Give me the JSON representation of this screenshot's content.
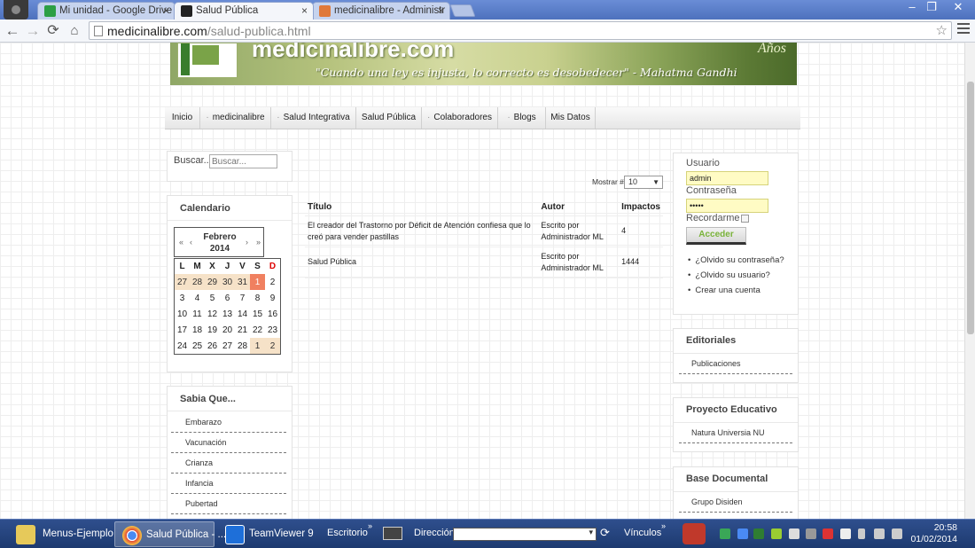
{
  "browser": {
    "tabs": [
      {
        "label": "Mi unidad - Google Drive",
        "active": false,
        "favicon_color": "#2c9f45"
      },
      {
        "label": "Salud Pública",
        "active": true,
        "favicon_color": "#222222"
      },
      {
        "label": "medicinalibre - Administr",
        "active": false,
        "favicon_color": "#e0793a"
      }
    ],
    "url_domain": "medicinalibre.com",
    "url_path": "/salud-publica.html"
  },
  "banner": {
    "brand": "medicinalibre.com",
    "quote": "\"Cuando una ley es injusta, lo correcto es desobedecer\" - Mahatma Gandhi",
    "badge": "Años"
  },
  "mainnav": {
    "items": [
      "Inicio",
      "medicinalibre",
      "Salud Integrativa",
      "Salud Pública",
      "Colaboradores",
      "Blogs",
      "Mis Datos"
    ]
  },
  "search": {
    "label": "Buscar...",
    "placeholder": "Buscar..."
  },
  "calendar": {
    "title": "Calendario",
    "month": "Febrero",
    "year": "2014",
    "prev_year": "«",
    "prev_month": "‹",
    "next_month": "›",
    "next_year": "»",
    "weekdays": [
      "L",
      "M",
      "X",
      "J",
      "V",
      "S",
      "D"
    ],
    "weeks": [
      [
        "27",
        "28",
        "29",
        "30",
        "31",
        "1",
        "2"
      ],
      [
        "3",
        "4",
        "5",
        "6",
        "7",
        "8",
        "9"
      ],
      [
        "10",
        "11",
        "12",
        "13",
        "14",
        "15",
        "16"
      ],
      [
        "17",
        "18",
        "19",
        "20",
        "21",
        "22",
        "23"
      ],
      [
        "24",
        "25",
        "26",
        "27",
        "28",
        "1",
        "2"
      ]
    ]
  },
  "sabia": {
    "title": "Sabia Que...",
    "items": [
      "Embarazo",
      "Vacunación",
      "Crianza",
      "Infancia",
      "Pubertad"
    ]
  },
  "articles": {
    "mostrar_label": "Mostrar #",
    "mostrar_value": "10",
    "columns": [
      "Título",
      "Autor",
      "Impactos"
    ],
    "rows": [
      {
        "title": "El creador del Trastorno por Déficit de Atención confiesa que lo creó para vender pastillas",
        "author": "Escrito por Administrador ML",
        "hits": "4"
      },
      {
        "title": "Salud Pública",
        "author": "Escrito por Administrador ML",
        "hits": "1444"
      }
    ]
  },
  "login": {
    "user_label": "Usuario",
    "user_value": "admin",
    "pass_label": "Contraseña",
    "pass_value": "•••••",
    "remember_label": "Recordarme",
    "submit": "Acceder",
    "links": [
      "¿Olvido su contraseña?",
      "¿Olvido su usuario?",
      "Crear una cuenta"
    ]
  },
  "editoriales": {
    "title": "Editoriales",
    "items": [
      "Publicaciones"
    ]
  },
  "proyecto": {
    "title": "Proyecto Educativo",
    "items": [
      "Natura Universia NU"
    ]
  },
  "base": {
    "title": "Base Documental",
    "items": [
      "Grupo Disiden"
    ]
  },
  "taskbar": {
    "buttons": [
      "Menus-Ejemplo",
      "Salud Pública - ...",
      "TeamViewer 9"
    ],
    "escritorio": "Escritorio",
    "direccion": "Dirección",
    "vinculos": "Vínculos",
    "time": "20:58",
    "date": "01/02/2014"
  }
}
